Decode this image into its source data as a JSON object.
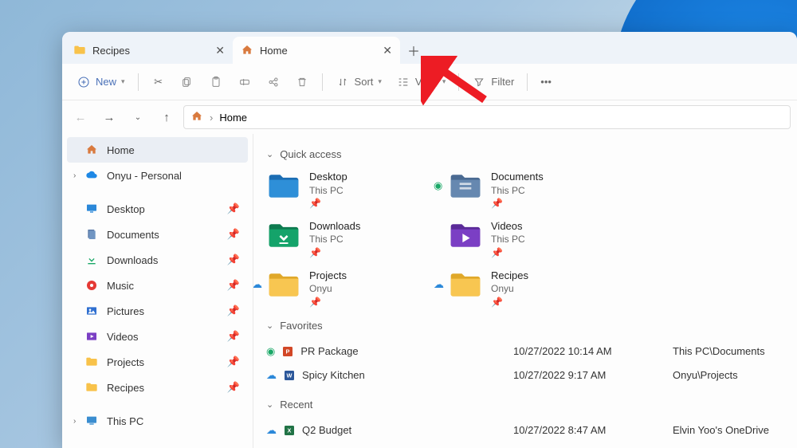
{
  "tabs": [
    {
      "label": "Recipes",
      "active": false
    },
    {
      "label": "Home",
      "active": true
    }
  ],
  "toolbar": {
    "new": "New",
    "sort": "Sort",
    "view": "View",
    "filter": "Filter"
  },
  "address": {
    "path_label": "Home",
    "separator": "›"
  },
  "sidebar": {
    "tree": [
      {
        "label": "Home",
        "icon": "home"
      },
      {
        "label": "Onyu - Personal",
        "icon": "onedrive",
        "expandable": true
      }
    ],
    "pinned": [
      {
        "label": "Desktop",
        "icon": "desktop"
      },
      {
        "label": "Documents",
        "icon": "documents"
      },
      {
        "label": "Downloads",
        "icon": "downloads"
      },
      {
        "label": "Music",
        "icon": "music"
      },
      {
        "label": "Pictures",
        "icon": "pictures"
      },
      {
        "label": "Videos",
        "icon": "videos"
      },
      {
        "label": "Projects",
        "icon": "folder"
      },
      {
        "label": "Recipes",
        "icon": "folder"
      }
    ],
    "bottom": [
      {
        "label": "This PC",
        "icon": "thispc"
      }
    ]
  },
  "sections": {
    "quick": "Quick access",
    "favorites": "Favorites",
    "recent": "Recent"
  },
  "quick_access": [
    {
      "title": "Desktop",
      "sub": "This PC",
      "icon": "desktop",
      "sync": ""
    },
    {
      "title": "Documents",
      "sub": "This PC",
      "icon": "documents",
      "sync": "green"
    },
    {
      "title": "Downloads",
      "sub": "This PC",
      "icon": "downloads",
      "sync": ""
    },
    {
      "title": "Videos",
      "sub": "This PC",
      "icon": "videos",
      "sync": ""
    },
    {
      "title": "Projects",
      "sub": "Onyu",
      "icon": "folder",
      "sync": "cloud"
    },
    {
      "title": "Recipes",
      "sub": "Onyu",
      "icon": "folder",
      "sync": "cloud"
    }
  ],
  "favorites_list": [
    {
      "name": "PR Package",
      "date": "10/27/2022 10:14 AM",
      "loc": "This PC\\Documents",
      "sync": "green",
      "ftype": "ppt"
    },
    {
      "name": "Spicy Kitchen",
      "date": "10/27/2022 9:17 AM",
      "loc": "Onyu\\Projects",
      "sync": "cloud",
      "ftype": "word"
    }
  ],
  "recent_list": [
    {
      "name": "Q2 Budget",
      "date": "10/27/2022 8:47 AM",
      "loc": "Elvin Yoo's OneDrive",
      "sync": "cloud",
      "ftype": "excel"
    }
  ]
}
